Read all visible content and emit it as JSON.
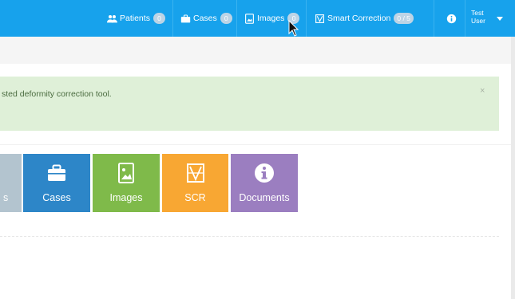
{
  "nav": {
    "patients": {
      "label": "Patients",
      "badge": "0",
      "icon": "users-icon"
    },
    "cases": {
      "label": "Cases",
      "badge": "0",
      "icon": "briefcase-icon"
    },
    "images": {
      "label": "Images",
      "badge": "0",
      "icon": "image-file-icon"
    },
    "smart_correction": {
      "label": "Smart Correction",
      "badge": "0 / 5",
      "icon": "frame-icon"
    },
    "info_icon": "info-icon",
    "user": {
      "line1": "Test",
      "line2": "User"
    }
  },
  "alert": {
    "text": "sted deformity correction tool.",
    "close": "×"
  },
  "tiles": [
    {
      "label": "s",
      "color": "#b3c4cf",
      "icon": ""
    },
    {
      "label": "Cases",
      "color": "#2d86c8",
      "icon": "briefcase-icon"
    },
    {
      "label": "Images",
      "color": "#7fba4a",
      "icon": "image-icon"
    },
    {
      "label": "SCR",
      "color": "#f8a733",
      "icon": "frame-icon"
    },
    {
      "label": "Documents",
      "color": "#9b7ec0",
      "icon": "info-circle-icon"
    }
  ],
  "colors": {
    "navbar": "#17a2ec",
    "alert_bg": "#dff0d8"
  }
}
